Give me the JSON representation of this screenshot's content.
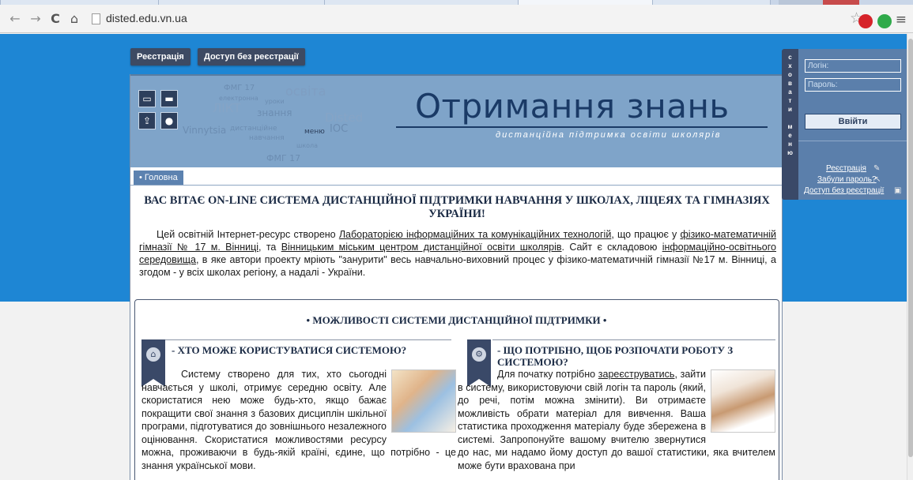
{
  "browser": {
    "url": "disted.edu.vn.ua",
    "back_icon": "←",
    "forward_icon": "→",
    "reload_icon": "C",
    "home_icon": "⌂",
    "star_icon": "☆",
    "menu_icon": "≡"
  },
  "topnav": {
    "register": "Реєстрація",
    "guest_access": "Доступ без реєстрації"
  },
  "banner": {
    "title": "Отримання знань",
    "tagline": "дистанційна підтримка освіти школярів",
    "cloud_words": [
      "ФМГ 17",
      "освіта",
      "електронна",
      "уроки",
      "ЛІКТ",
      "знання",
      "Disted",
      "Vinnytsia",
      "дистанційне",
      "навчання",
      "меню",
      "IOC",
      "школа",
      "ФМГ 17"
    ]
  },
  "breadcrumb": "• Головна",
  "welcome": "ВАС ВІТАЄ ON-LINE СИСТЕМА ДИСТАНЦІЙНОЇ ПІДТРИМКИ НАВЧАННЯ У ШКОЛАХ, ЛІЦЕЯХ ТА ГІМНАЗІЯХ УКРАЇНИ!",
  "intro": {
    "p1": "Цей освітній Інтернет-ресурс створено ",
    "link1": "Лабораторією інформаційних та комунікаційних технологій",
    "p2": ", що працює у ",
    "link2": "фізико-математичній гімназії № 17 м. Вінниці",
    "p3": ", та ",
    "link3": "Вінницьким міським центром дистанційної освіти школярів",
    "p4": ". Сайт є складовою ",
    "link4": "інформаційно-освітнього середовища",
    "p5": ", в яке автори проекту мріють \"занурити\" весь навчально-виховний процес у фізико-математичній гімназії №17 м. Вінниці, а згодом - у всіх школах регіону, а надалі - України."
  },
  "features": {
    "title": "• МОЖЛИВОСТІ СИСТЕМИ ДИСТАНЦІЙНОЇ ПІДТРИМКИ •",
    "left": {
      "title": "- ХТО МОЖЕ КОРИСТУВАТИСЯ СИСТЕМОЮ?",
      "text": "Систему створено для тих, хто сьогодні навчається у школі, отримує середню освіту. Але скористатися нею може будь-хто, якщо бажає покращити свої знання з базових дисциплін шкільної програми, підготуватися до зовнішнього незалежного оцінювання. Скористатися можливостями ресурсу можна, проживаючи в будь-якій країні, єдине, що потрібно - це знання української мови."
    },
    "right": {
      "title": "- ЩО ПОТРІБНО, ЩОБ РОЗПОЧАТИ РОБОТУ З СИСТЕМОЮ?",
      "text_pre": "Для початку потрібно ",
      "text_link": "зареєструватись",
      "text_post": ", зайти в систему, використовуючи свій логін та пароль (який, до речі, потім можна змінити). Ви отримаєте можливість обрати матеріал для вивчення. Ваша статистика проходження матеріалу буде збережена в системі. Запропонуйте вашому вчителю звернутися до нас, ми надамо йому доступ до вашої статистики, яка вчителем може бути врахована при"
    }
  },
  "sidebar": {
    "tab_letters": [
      "с",
      "х",
      "о",
      "в",
      "а",
      "т",
      "и",
      "",
      "м",
      "е",
      "н",
      "ю"
    ],
    "login_placeholder": "Логін:",
    "password_placeholder": "Пароль:",
    "login_button": "Ввійти",
    "register_link": "Реєстрація",
    "forgot_link": "Забули пароль?",
    "guest_link": "Доступ без реєстрації"
  }
}
